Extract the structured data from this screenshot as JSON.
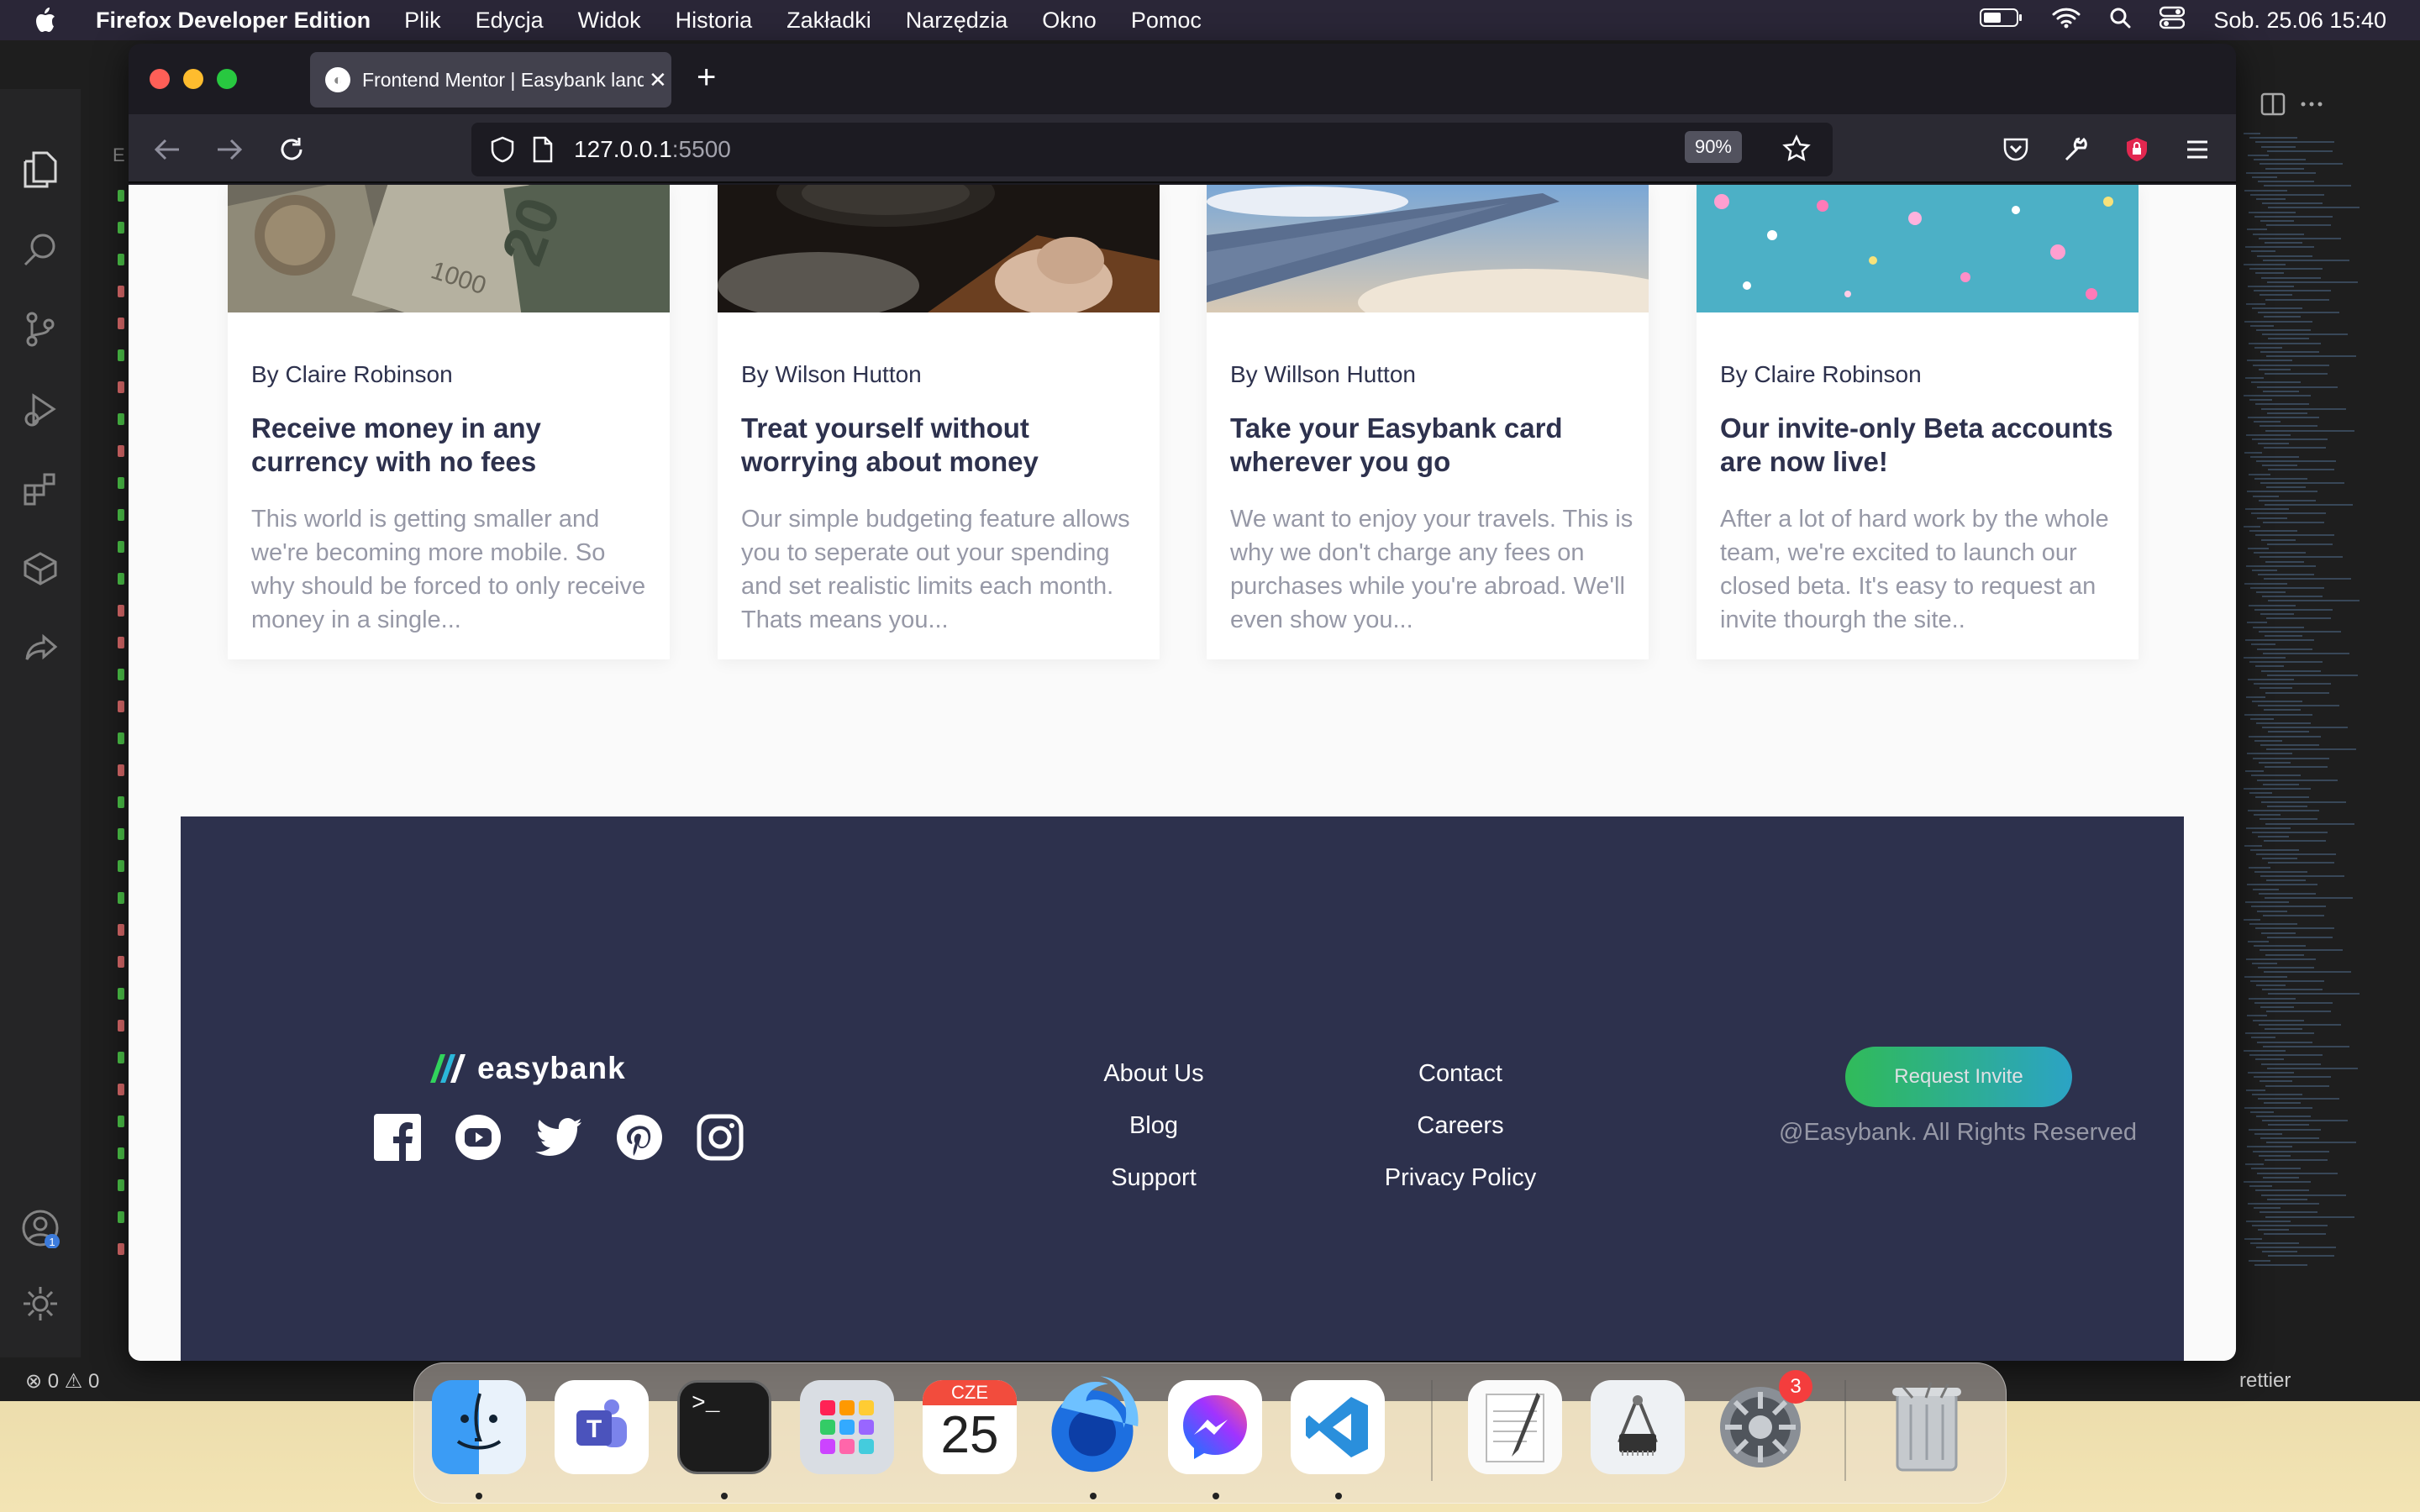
{
  "menubar": {
    "app_name": "Firefox Developer Edition",
    "items": [
      "Plik",
      "Edycja",
      "Widok",
      "Historia",
      "Zakładki",
      "Narzędzia",
      "Okno",
      "Pomoc"
    ],
    "datetime": "Sob. 25.06  15:40",
    "icons": [
      "battery-icon",
      "wifi-icon",
      "spotlight-search-icon",
      "control-center-icon"
    ]
  },
  "vscode": {
    "explorer_letter": "E",
    "status_errors": "0",
    "status_warnings": "0",
    "status_right": "rettier",
    "accounts_badge": "1"
  },
  "browser": {
    "tab_title": "Frontend Mentor | Easybank landing page",
    "url_host": "127.0.0.1",
    "url_port": ":5500",
    "zoom": "90%"
  },
  "articles": [
    {
      "author": "By Claire Robinson",
      "title": "Receive money in any currency with no fees",
      "excerpt": "This world is getting smaller and we're becoming more mobile. So why should be forced to only receive money in a single..."
    },
    {
      "author": "By Wilson Hutton",
      "title": "Treat yourself without worrying about money",
      "excerpt": "Our simple budgeting feature allows you to seperate out your spending and set realistic limits each month. Thats means you..."
    },
    {
      "author": "By Willson Hutton",
      "title": "Take your Easybank card wherever you go",
      "excerpt": "We want to enjoy your travels. This is why we don't charge any fees on purchases while you're abroad. We'll even show you..."
    },
    {
      "author": "By Claire Robinson",
      "title": "Our invite-only Beta accounts are now live!",
      "excerpt": "After a lot of hard work by the whole team, we're excited to launch our closed beta. It's easy to request an invite thourgh the site.."
    }
  ],
  "footer": {
    "logo_text": "easybank",
    "links_col1": [
      "About Us",
      "Blog",
      "Support"
    ],
    "links_col2": [
      "Contact",
      "Careers",
      "Privacy Policy"
    ],
    "cta": "Request Invite",
    "copyright": "@Easybank. All Rights Reserved",
    "socials": [
      "facebook-icon",
      "youtube-icon",
      "twitter-icon",
      "pinterest-icon",
      "instagram-icon"
    ]
  },
  "dock": {
    "calendar_month": "CZE",
    "calendar_day": "25",
    "settings_badge": "3",
    "apps": [
      "Finder",
      "Microsoft Teams",
      "Terminal",
      "Launchpad",
      "Calendar",
      "Firefox Developer Edition",
      "Messenger",
      "Visual Studio Code",
      "TextEdit",
      "System Information",
      "System Preferences",
      "Trash"
    ]
  },
  "colors": {
    "footer_bg": "#2d314d",
    "cta_start": "#31d35c",
    "cta_end": "#2bb7da",
    "text_dark": "#2d314d",
    "text_gray": "#9698a6"
  }
}
